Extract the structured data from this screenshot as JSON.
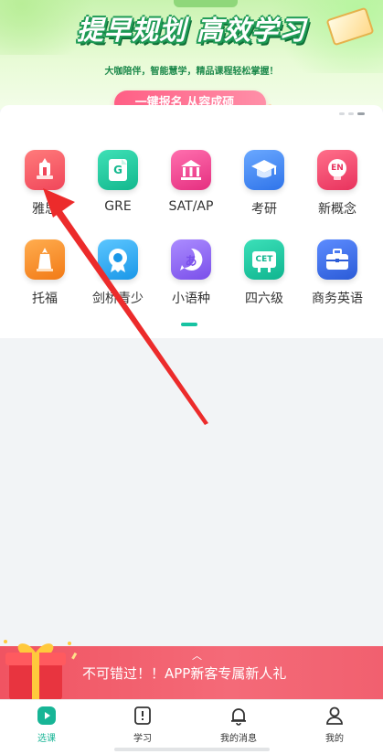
{
  "banner": {
    "title": "提早规划 高效学习",
    "subtitle": "大咖陪伴，智能慧学，精品课程轻松掌握！",
    "cta_label": "一键报名 从容成硕"
  },
  "categories": [
    {
      "label": "雅思",
      "icon": "ielts-icon",
      "color": "#f0465a"
    },
    {
      "label": "GRE",
      "icon": "gre-icon",
      "color": "#19c39a",
      "glyph": "G"
    },
    {
      "label": "SAT/AP",
      "icon": "sat-ap-icon",
      "color": "#ee3d8d"
    },
    {
      "label": "考研",
      "icon": "graduation-cap-icon",
      "color": "#3f86f2"
    },
    {
      "label": "新概念",
      "icon": "new-concept-icon",
      "color": "#ef3f6d",
      "glyph": "EN"
    },
    {
      "label": "托福",
      "icon": "toefl-icon",
      "color": "#f78a23"
    },
    {
      "label": "剑桥青少",
      "icon": "cambridge-icon",
      "color": "#27a8f0"
    },
    {
      "label": "小语种",
      "icon": "minor-language-icon",
      "color": "#8b63ef",
      "glyph": "あ"
    },
    {
      "label": "四六级",
      "icon": "cet-icon",
      "color": "#16c4a0",
      "glyph": "CET"
    },
    {
      "label": "商务英语",
      "icon": "briefcase-icon",
      "color": "#3466e0"
    }
  ],
  "promo": {
    "text": "不可错过！！APP新客专属新人礼"
  },
  "tabbar": {
    "items": [
      {
        "label": "选课",
        "icon": "play-icon",
        "active": true
      },
      {
        "label": "学习",
        "icon": "study-icon",
        "active": false
      },
      {
        "label": "我的消息",
        "icon": "bell-icon",
        "active": false
      },
      {
        "label": "我的",
        "icon": "user-icon",
        "active": false
      }
    ]
  },
  "accent_color": "#17b596"
}
